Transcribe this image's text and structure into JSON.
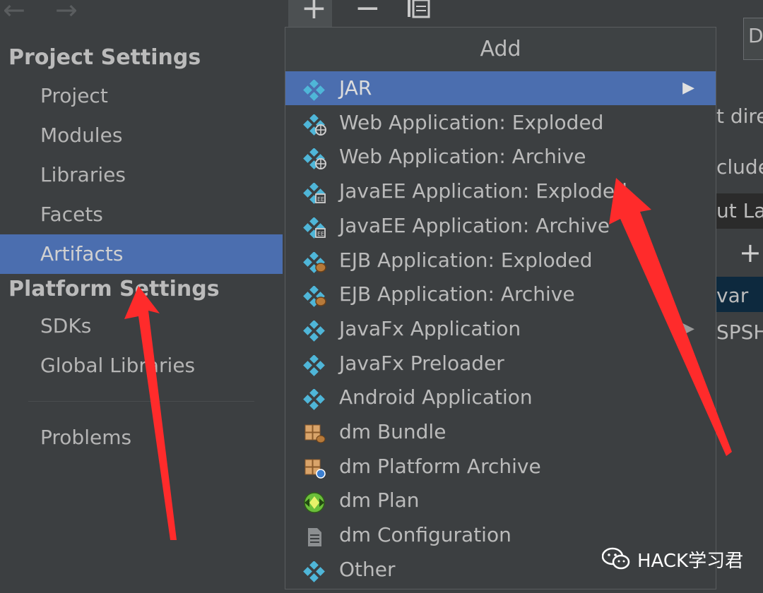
{
  "left_panel": {
    "project_settings_title": "Project Settings",
    "project_items": [
      "Project",
      "Modules",
      "Libraries",
      "Facets",
      "Artifacts"
    ],
    "selected_item": "Artifacts",
    "platform_settings_title": "Platform Settings",
    "platform_items": [
      "SDKs",
      "Global Libraries"
    ],
    "problems_label": "Problems"
  },
  "toolbar": {
    "add_icon": "plus-icon",
    "remove_icon": "minus-icon",
    "copy_icon": "copy-icon"
  },
  "popup": {
    "title": "Add",
    "items": [
      {
        "label": "JAR",
        "icon": "artifact-icon",
        "submenu": true,
        "selected": true
      },
      {
        "label": "Web Application: Exploded",
        "icon": "web-artifact-icon"
      },
      {
        "label": "Web Application: Archive",
        "icon": "web-artifact-icon"
      },
      {
        "label": "JavaEE Application: Exploded",
        "icon": "javaee-artifact-icon"
      },
      {
        "label": "JavaEE Application: Archive",
        "icon": "javaee-artifact-icon"
      },
      {
        "label": "EJB Application: Exploded",
        "icon": "ejb-artifact-icon"
      },
      {
        "label": "EJB Application: Archive",
        "icon": "ejb-artifact-icon"
      },
      {
        "label": "JavaFx Application",
        "icon": "artifact-icon",
        "submenu": true
      },
      {
        "label": "JavaFx Preloader",
        "icon": "artifact-icon"
      },
      {
        "label": "Android Application",
        "icon": "artifact-icon"
      },
      {
        "label": "dm Bundle",
        "icon": "dm-bundle-icon"
      },
      {
        "label": "dm Platform Archive",
        "icon": "dm-platform-icon"
      },
      {
        "label": "dm Plan",
        "icon": "dm-plan-icon"
      },
      {
        "label": "dm Configuration",
        "icon": "document-icon"
      },
      {
        "label": "Other",
        "icon": "artifact-icon"
      }
    ]
  },
  "right_partial": {
    "line1": "t dire",
    "line2": "clude",
    "line3": "ut La",
    "line4": "var",
    "line5": "SPSH",
    "add_icon": "plus-icon",
    "box_text": "D"
  },
  "watermark": {
    "text": "HACK学习君",
    "icon": "wechat-icon"
  },
  "colors": {
    "background": "#3c3f41",
    "selection": "#4b6eaf",
    "annotation_arrow": "#ff2a2a",
    "artifact_icon": "#4fb6d8"
  }
}
